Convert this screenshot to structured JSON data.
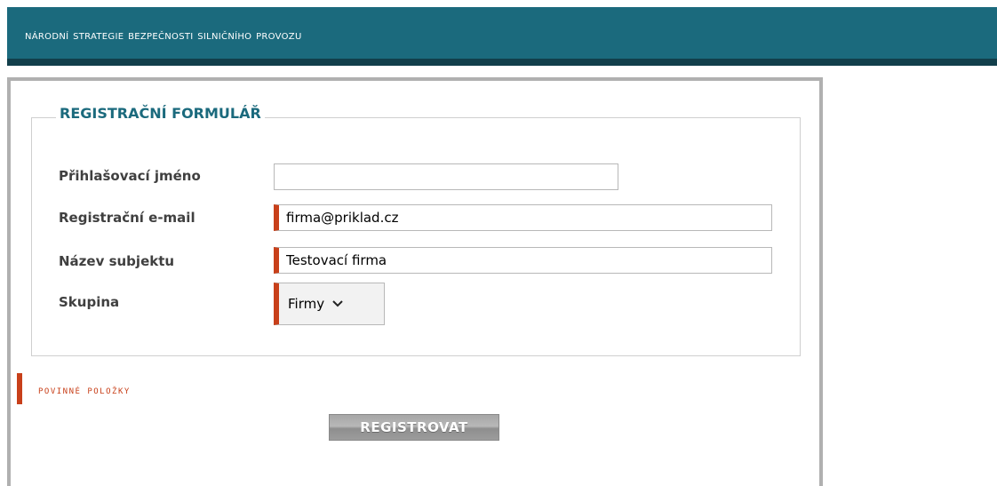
{
  "header": {
    "title": "Národní strategie bezpečnosti silničního provozu"
  },
  "form": {
    "legend": "REGISTRAČNÍ FORMULÁŘ",
    "fields": [
      {
        "label": "Přihlašovací jméno",
        "value": "",
        "required": false
      },
      {
        "label": "Registrační e-mail",
        "value": "firma@priklad.cz",
        "required": true
      },
      {
        "label": "Název subjektu",
        "value": "Testovací firma",
        "required": true
      }
    ],
    "group": {
      "label": "Skupina",
      "selected": "Firmy",
      "required": true
    },
    "required_note": "POVINNÉ POLOŽKY",
    "submit_label": "REGISTROVAT"
  },
  "colors": {
    "header_bg": "#1b6a7d",
    "header_dark": "#123f4b",
    "accent_required": "#c8401a",
    "legend_text": "#1b6a7d"
  },
  "icons": {
    "select_arrow": "chevron-down-icon"
  }
}
